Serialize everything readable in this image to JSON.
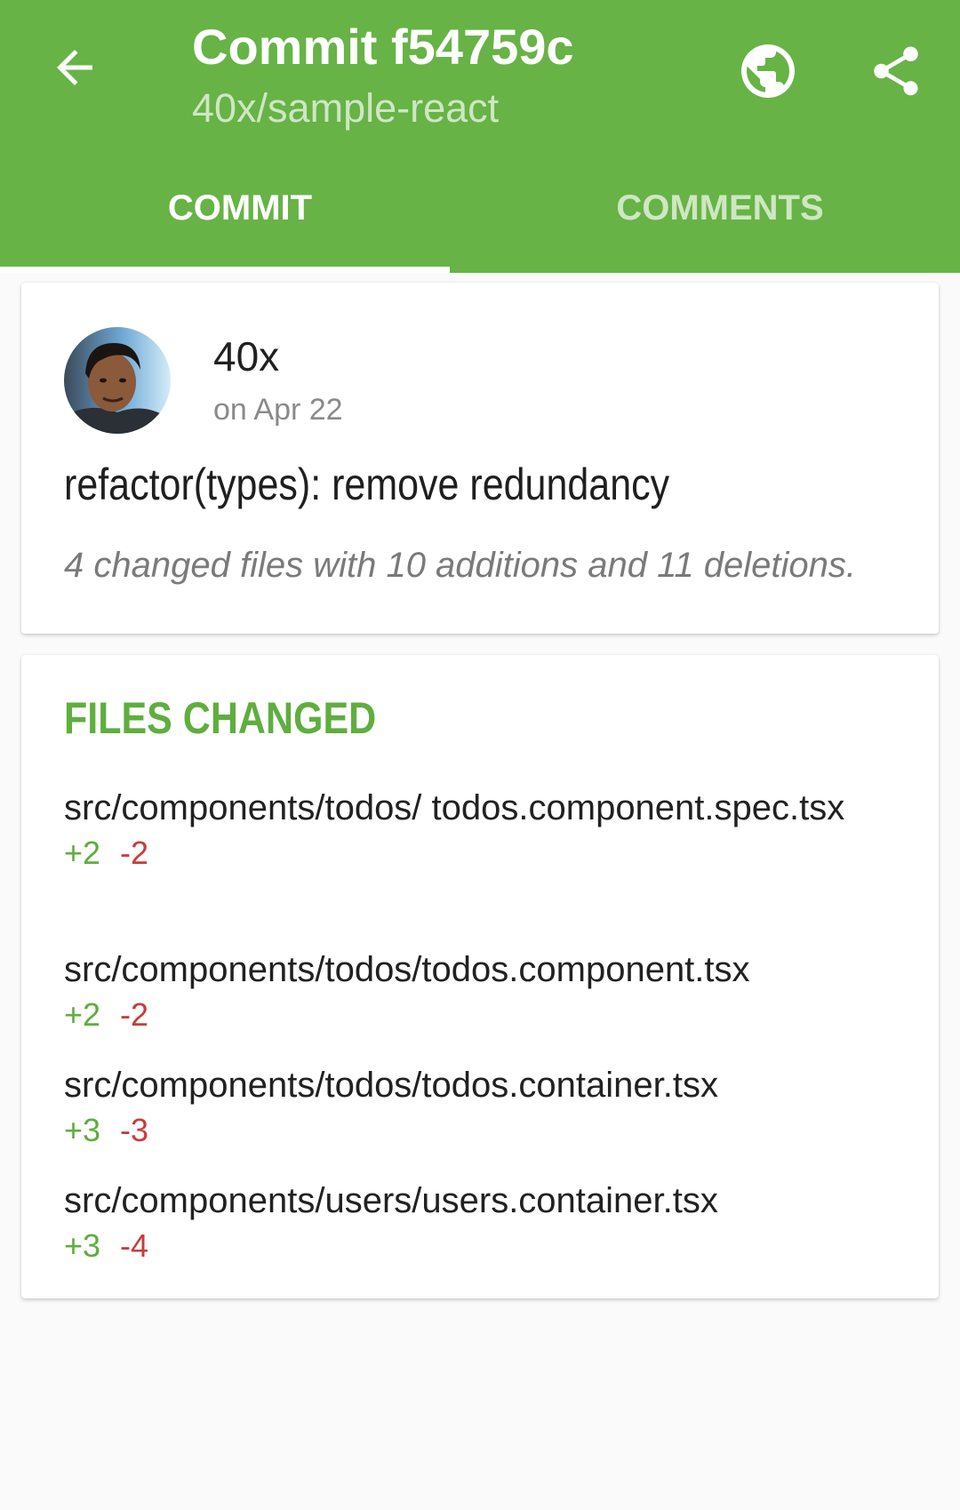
{
  "header": {
    "title": "Commit f54759c",
    "subtitle": "40x/sample-react",
    "back_icon": "arrow-back-icon",
    "globe_icon": "globe-icon",
    "share_icon": "share-icon",
    "background_color": "#67b346"
  },
  "tabs": [
    {
      "label": "COMMIT",
      "active": true
    },
    {
      "label": "COMMENTS",
      "active": false
    }
  ],
  "commit": {
    "author": "40x",
    "date": "on Apr 22",
    "message": "refactor(types): remove redundancy",
    "summary": "4 changed files with 10 additions and 11 deletions."
  },
  "files": {
    "heading": "FILES CHANGED",
    "items": [
      {
        "path": "src/components/todos/ todos.component.spec.tsx",
        "additions": "+2",
        "deletions": "-2"
      },
      {
        "path": "src/components/todos/todos.component.tsx",
        "additions": "+2",
        "deletions": "-2"
      },
      {
        "path": "src/components/todos/todos.container.tsx",
        "additions": "+3",
        "deletions": "-3"
      },
      {
        "path": "src/components/users/users.container.tsx",
        "additions": "+3",
        "deletions": "-4"
      }
    ]
  },
  "colors": {
    "accent": "#67b346",
    "additions": "#5fae3e",
    "deletions": "#c83c3c"
  }
}
